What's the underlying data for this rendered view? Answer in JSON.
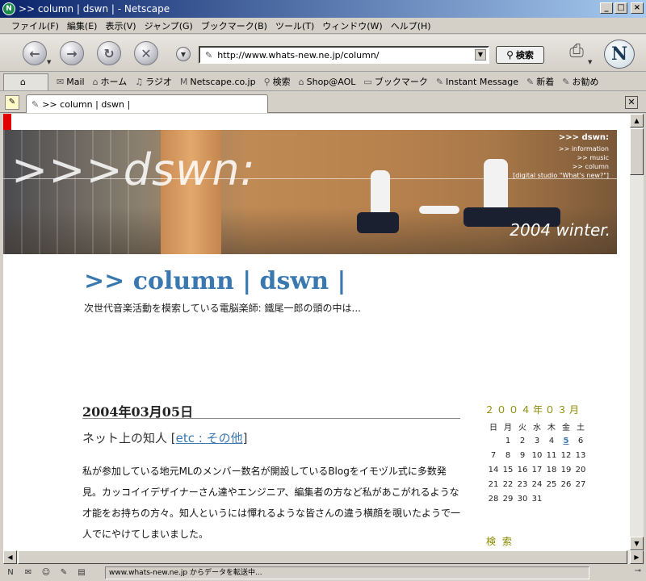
{
  "window": {
    "title": ">> column | dswn | - Netscape",
    "app_icon": "N"
  },
  "menu": [
    "ファイル(F)",
    "編集(E)",
    "表示(V)",
    "ジャンプ(G)",
    "ブックマーク(B)",
    "ツール(T)",
    "ウィンドウ(W)",
    "ヘルプ(H)"
  ],
  "nav": {
    "url": "http://www.whats-new.ne.jp/column/",
    "search_label": "検索"
  },
  "bookmarks": {
    "items": [
      {
        "label": "Mail",
        "icon": "mail-icon",
        "glyph": "✉"
      },
      {
        "label": "ホーム",
        "icon": "home-icon",
        "glyph": "⌂"
      },
      {
        "label": "ラジオ",
        "icon": "radio-icon",
        "glyph": "♫"
      },
      {
        "label": "Netscape.co.jp",
        "icon": "my-icon",
        "glyph": "M"
      },
      {
        "label": "検索",
        "icon": "search-icon",
        "glyph": "⚲"
      },
      {
        "label": "Shop@AOL",
        "icon": "shop-icon",
        "glyph": "⌂"
      },
      {
        "label": "ブックマーク",
        "icon": "folder-icon",
        "glyph": "▭"
      },
      {
        "label": "Instant Message",
        "icon": "bookmark-icon",
        "glyph": "✎"
      },
      {
        "label": "新着",
        "icon": "bookmark-icon",
        "glyph": "✎"
      },
      {
        "label": "お勧め",
        "icon": "bookmark-icon",
        "glyph": "✎"
      }
    ]
  },
  "tab": {
    "label": ">> column | dswn |"
  },
  "banner": {
    "logo": ">>>dswn:",
    "site_name": ">>> dswn:",
    "nav_lines": [
      ">> information",
      ">> music",
      ">> column",
      "[digital studio \"What's new?\"]"
    ],
    "season": "2004 winter."
  },
  "blog": {
    "title": ">> column | dswn |",
    "description": "次世代音楽活動を模索している電脳楽師: 鐵尾一郎の頭の中は...",
    "post_date": "2004年03月05日",
    "post_title": "ネット上の知人",
    "post_category": "etc : その他",
    "post_body": "私が参加している地元MLのメンバー数名が開設しているBlogをイモヅル式に多数発見。カッコイイデザイナーさん達やエンジニア、編集者の方など私があこがれるような才能をお持ちの方々。知人というには憚れるような皆さんの違う横顔を覗いたようで一人でにやけてしまいました。"
  },
  "calendar": {
    "title": "２００４年０３月",
    "weekdays": [
      "日",
      "月",
      "火",
      "水",
      "木",
      "金",
      "土"
    ],
    "weeks": [
      [
        "",
        "1",
        "2",
        "3",
        "4",
        "5",
        "6"
      ],
      [
        "7",
        "8",
        "9",
        "10",
        "11",
        "12",
        "13"
      ],
      [
        "14",
        "15",
        "16",
        "17",
        "18",
        "19",
        "20"
      ],
      [
        "21",
        "22",
        "23",
        "24",
        "25",
        "26",
        "27"
      ],
      [
        "28",
        "29",
        "30",
        "31",
        "",
        "",
        ""
      ]
    ],
    "today": "5"
  },
  "sidebar": {
    "search_heading": "検 索"
  },
  "status": {
    "text": "www.whats-new.ne.jp からデータを転送中..."
  }
}
